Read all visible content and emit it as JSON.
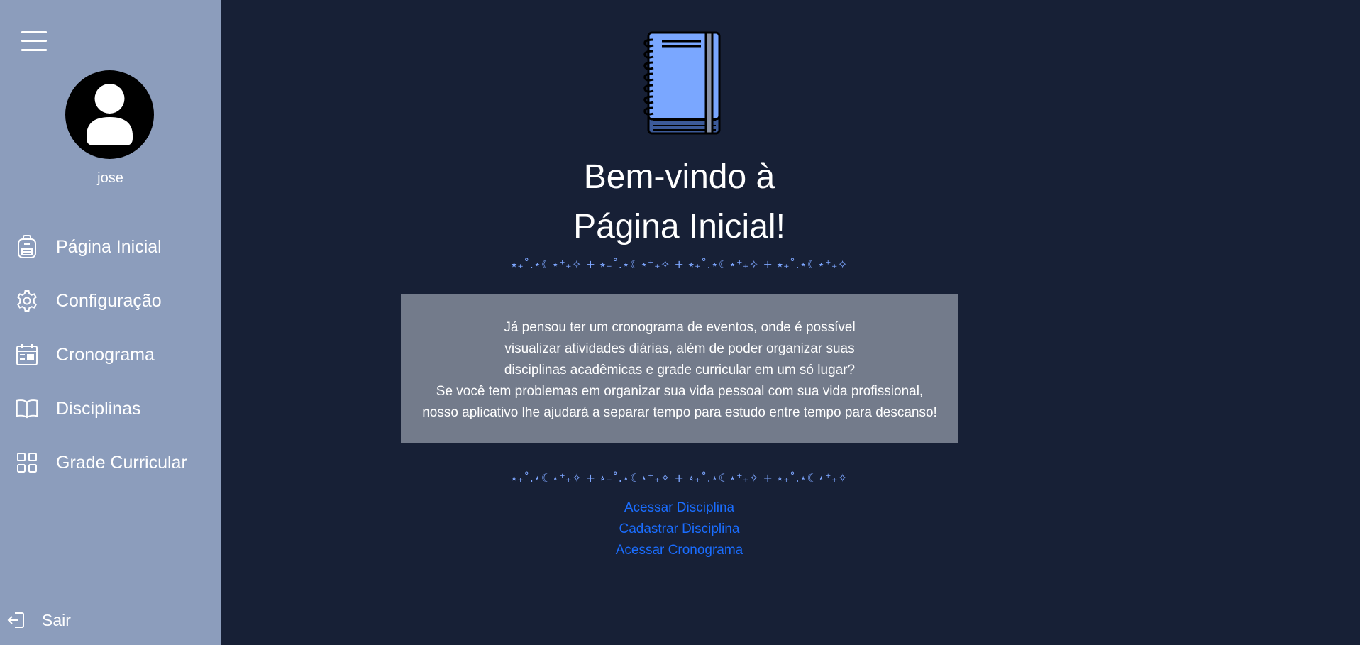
{
  "user": {
    "name": "jose"
  },
  "sidebar": {
    "items": [
      {
        "label": "Página Inicial",
        "icon": "backpack-icon"
      },
      {
        "label": "Configuração",
        "icon": "gear-icon"
      },
      {
        "label": "Cronograma",
        "icon": "calendar-icon"
      },
      {
        "label": "Disciplinas",
        "icon": "book-icon"
      },
      {
        "label": "Grade Curricular",
        "icon": "grid-icon"
      }
    ],
    "logout_label": "Sair"
  },
  "main": {
    "title_line1": "Bem-vindo à",
    "title_line2": "Página Inicial!",
    "divider": "⭒₊˚.⋆☾⋆⁺₊✧ + ⭒₊˚.⋆☾⋆⁺₊✧ + ⭒₊˚.⋆☾⋆⁺₊✧ + ⭒₊˚.⋆☾⋆⁺₊✧",
    "info_lines": [
      "Já pensou ter um cronograma de eventos, onde é possível",
      "visualizar atividades diárias, além de poder organizar suas",
      "disciplinas acadêmicas e grade curricular em um só lugar?",
      "Se você tem problemas em organizar sua vida pessoal com sua vida profissional,",
      "nosso aplicativo lhe ajudará a separar tempo para estudo entre tempo para descanso!"
    ],
    "links": [
      "Acessar Disciplina",
      "Cadastrar Disciplina",
      "Acessar Cronograma"
    ]
  },
  "colors": {
    "sidebar_bg": "#8c9dbc",
    "main_bg": "#172036",
    "info_box_bg": "#737b8b",
    "link": "#1a6dff",
    "divider": "#7da6ff",
    "notebook": "#7aa7ff"
  }
}
